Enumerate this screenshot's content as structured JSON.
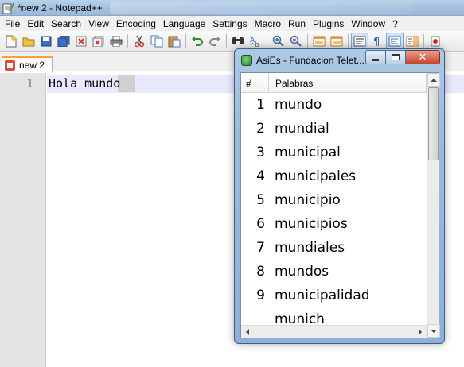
{
  "app": {
    "title": "*new  2 - Notepad++"
  },
  "menu": [
    "File",
    "Edit",
    "Search",
    "View",
    "Encoding",
    "Language",
    "Settings",
    "Macro",
    "Run",
    "Plugins",
    "Window",
    "?"
  ],
  "toolbar": {
    "buttons": [
      "new-file-icon",
      "open-file-icon",
      "save-icon",
      "save-all-icon",
      "close-icon",
      "close-all-icon",
      "print-icon",
      "cut-icon",
      "copy-icon",
      "paste-icon",
      "undo-icon",
      "redo-icon",
      "find-icon",
      "replace-icon",
      "zoom-in-icon",
      "zoom-out-icon",
      "sync-vertical-icon",
      "sync-horizontal-icon",
      "word-wrap-icon",
      "show-all-chars-icon",
      "indent-guide-icon",
      "document-map-icon",
      "record-macro-icon"
    ]
  },
  "tabs": [
    {
      "label": "new  2"
    }
  ],
  "editor": {
    "line_number": "1",
    "text": "Hola mundo"
  },
  "asies": {
    "title": "AsiEs - Fundacion Telet...",
    "columns": {
      "num": "#",
      "word": "Palabras"
    },
    "rows": [
      {
        "num": "1",
        "word": "mundo"
      },
      {
        "num": "2",
        "word": "mundial"
      },
      {
        "num": "3",
        "word": "municipal"
      },
      {
        "num": "4",
        "word": "municipales"
      },
      {
        "num": "5",
        "word": "municipio"
      },
      {
        "num": "6",
        "word": "municipios"
      },
      {
        "num": "7",
        "word": "mundiales"
      },
      {
        "num": "8",
        "word": "mundos"
      },
      {
        "num": "9",
        "word": "municipalidad"
      },
      {
        "num": "",
        "word": "munich"
      }
    ]
  },
  "colors": {
    "tab_accent": "#f9a13b",
    "current_line": "#e8e8ff",
    "window_frame": "#9dbadb",
    "close_button": "#c7432a"
  }
}
